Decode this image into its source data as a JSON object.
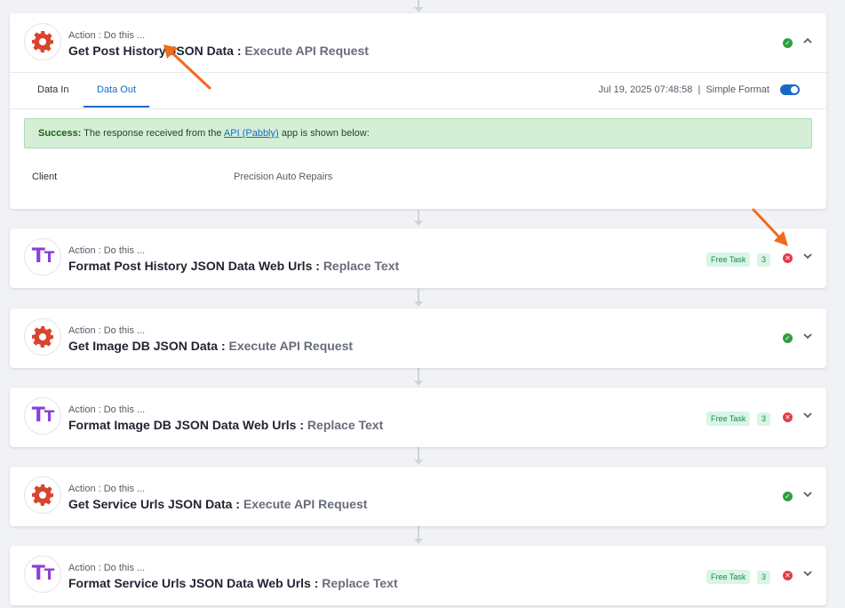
{
  "steps": [
    {
      "action_label": "Action : Do this ...",
      "title": "Get Post History JSON Data : ",
      "action": "Execute API Request",
      "icon": "gear-icon",
      "status": "success",
      "expanded": true,
      "tabs": [
        "Data In",
        "Data Out"
      ],
      "active_tab": "Data Out",
      "timestamp": "Jul 19, 2025 07:48:58",
      "separator": "|",
      "format_label": "Simple Format",
      "success_prefix": "Success:",
      "success_text_before": " The response received from the ",
      "success_link": "API (Pabbly)",
      "success_text_after": " app is shown below:",
      "field_label": "Client",
      "field_value": "Precision Auto Repairs"
    },
    {
      "action_label": "Action : Do this ...",
      "title": "Format Post History JSON Data Web Urls : ",
      "action": "Replace Text",
      "icon": "text-formatter-icon",
      "badge": "Free Task",
      "count": "3",
      "status": "error"
    },
    {
      "action_label": "Action : Do this ...",
      "title": "Get Image DB JSON Data : ",
      "action": "Execute API Request",
      "icon": "gear-icon",
      "status": "success"
    },
    {
      "action_label": "Action : Do this ...",
      "title": "Format Image DB JSON Data Web Urls : ",
      "action": "Replace Text",
      "icon": "text-formatter-icon",
      "badge": "Free Task",
      "count": "3",
      "status": "error"
    },
    {
      "action_label": "Action : Do this ...",
      "title": "Get Service Urls JSON Data : ",
      "action": "Execute API Request",
      "icon": "gear-icon",
      "status": "success"
    },
    {
      "action_label": "Action : Do this ...",
      "title": "Format Service Urls JSON Data Web Urls : ",
      "action": "Replace Text",
      "icon": "text-formatter-icon",
      "badge": "Free Task",
      "count": "3",
      "status": "error"
    }
  ],
  "colors": {
    "accent": "#1769c7",
    "success": "#2e9e3f",
    "error": "#e23c47",
    "gear": "#d9442f",
    "text_formatter": "#8b3fd9",
    "annotation_arrow": "#f26a1b"
  }
}
